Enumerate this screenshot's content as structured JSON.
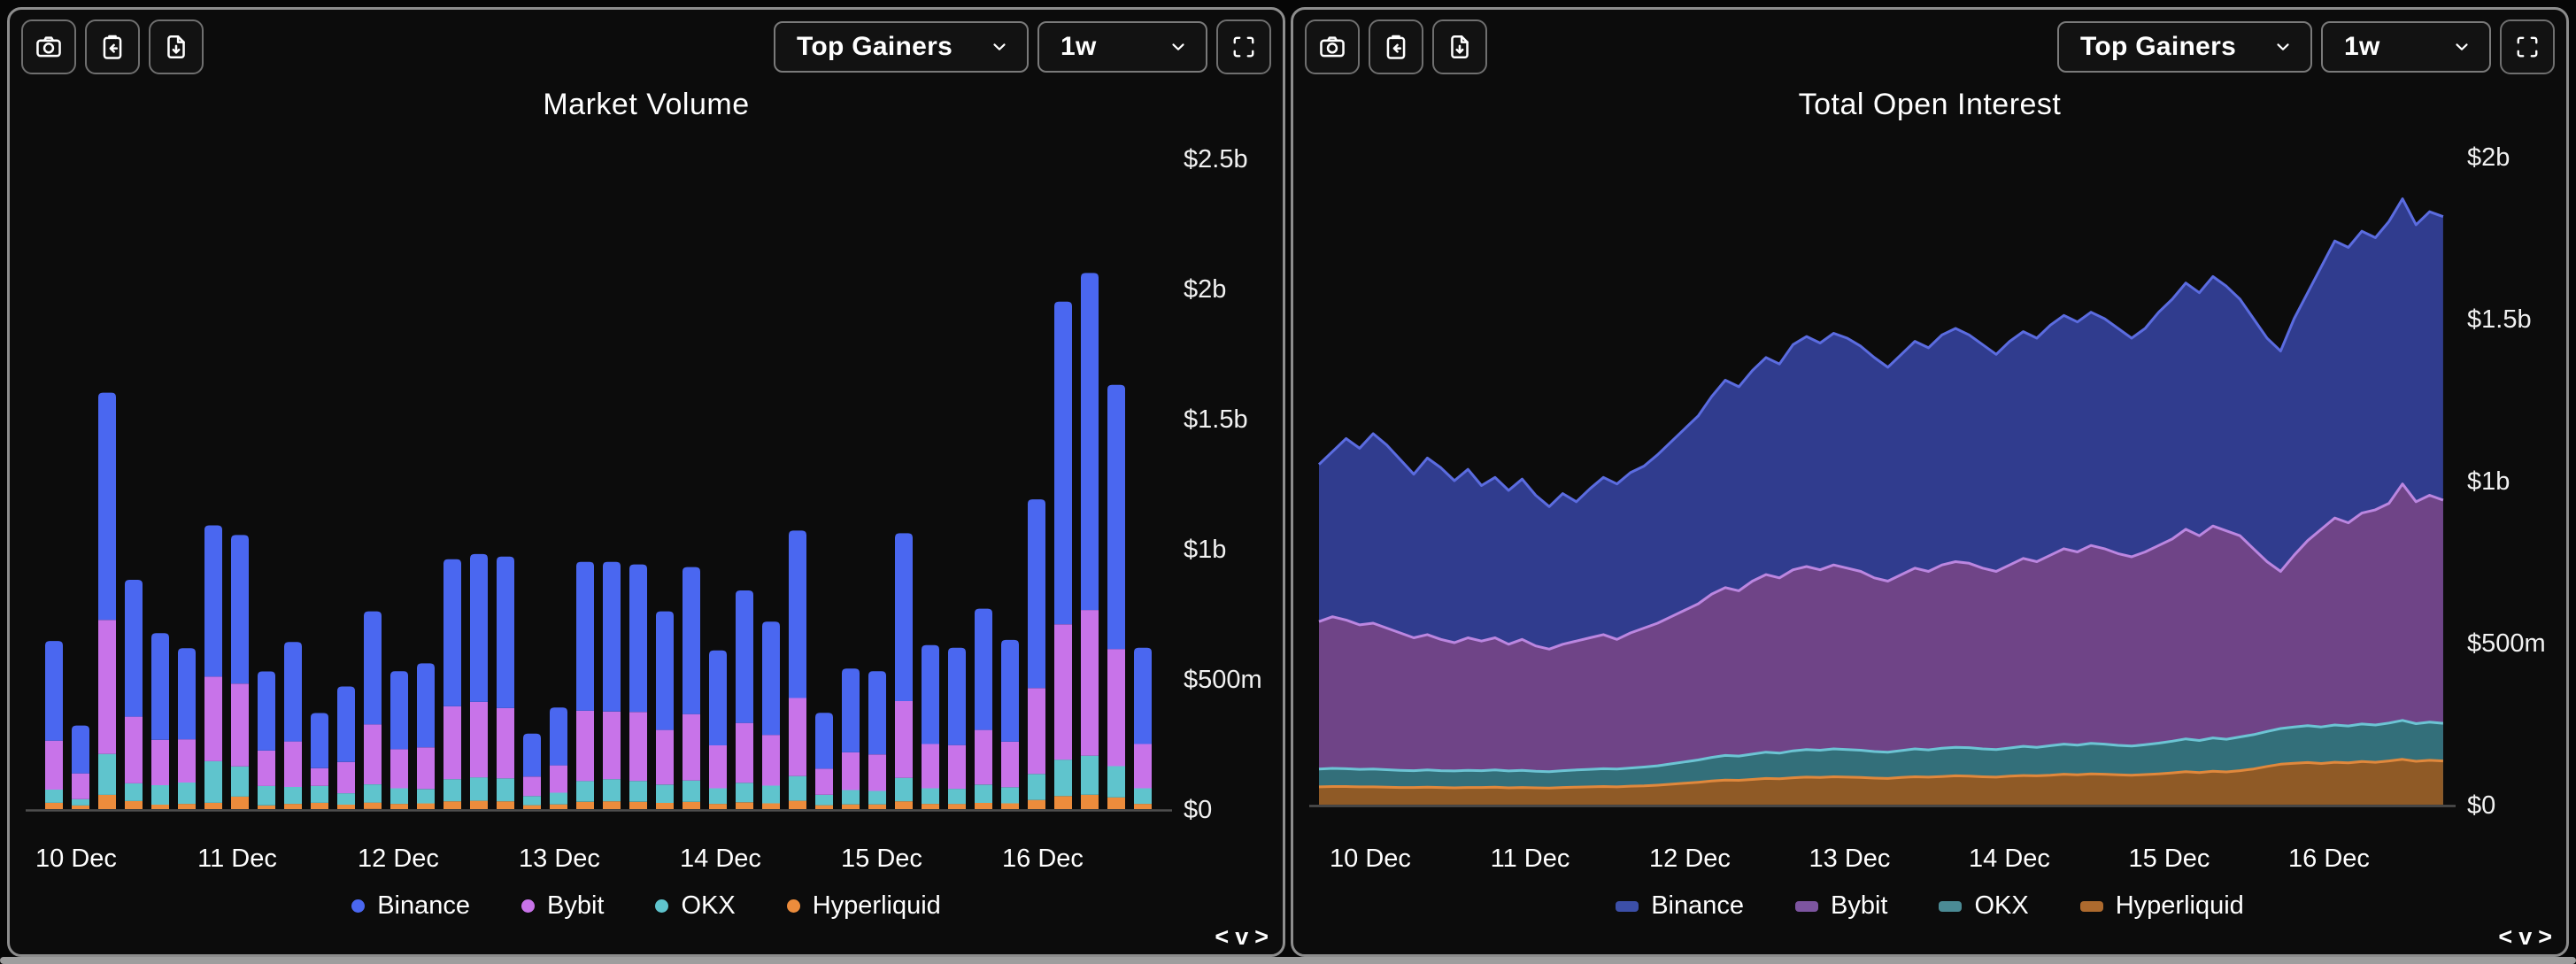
{
  "panels": [
    {
      "toolbar": {
        "screenshot_icon": "camera",
        "copy_icon": "clipboard-arrow",
        "export_icon": "file-download",
        "market_select": "Top Gainers",
        "range_select": "1w",
        "fullscreen_icon": "expand-corners"
      },
      "legend_marker": "dot",
      "legend": [
        {
          "label": "Binance",
          "color": "#4a67f0"
        },
        {
          "label": "Bybit",
          "color": "#c873e9"
        },
        {
          "label": "OKX",
          "color": "#5fc4cd"
        },
        {
          "label": "Hyperliquid",
          "color": "#ec8c3c"
        }
      ],
      "pager": [
        "<",
        "v",
        ">"
      ]
    },
    {
      "toolbar": {
        "screenshot_icon": "camera",
        "copy_icon": "clipboard-arrow",
        "export_icon": "file-download",
        "market_select": "Top Gainers",
        "range_select": "1w",
        "fullscreen_icon": "expand-corners"
      },
      "legend_marker": "chip",
      "legend": [
        {
          "label": "Binance",
          "color": "#3c4fa8"
        },
        {
          "label": "Bybit",
          "color": "#7d55a0"
        },
        {
          "label": "OKX",
          "color": "#4b8b95"
        },
        {
          "label": "Hyperliquid",
          "color": "#ad6a2e"
        }
      ],
      "pager": [
        "<",
        "v",
        ">"
      ]
    }
  ],
  "chart_data": [
    {
      "type": "bar",
      "title": "Market Volume",
      "unit": "USD millions",
      "interval": "4h",
      "x_labels": [
        "10 Dec",
        "11 Dec",
        "12 Dec",
        "13 Dec",
        "14 Dec",
        "15 Dec",
        "16 Dec"
      ],
      "y_ticks": [
        {
          "label": "$0",
          "value": 0
        },
        {
          "label": "$500m",
          "value": 500
        },
        {
          "label": "$1b",
          "value": 1000
        },
        {
          "label": "$1.5b",
          "value": 1500
        },
        {
          "label": "$2b",
          "value": 2000
        },
        {
          "label": "$2.5b",
          "value": 2500
        }
      ],
      "ylim": [
        0,
        2570
      ],
      "grid": false,
      "legend_position": "bottom",
      "series": [
        {
          "name": "Hyperliquid",
          "color": "#ec8c3c",
          "values": [
            24,
            14,
            55,
            31,
            17,
            20,
            24,
            48,
            14,
            20,
            24,
            17,
            25,
            20,
            22,
            30,
            32,
            30,
            15,
            18,
            28,
            30,
            28,
            24,
            28,
            20,
            26,
            22,
            32,
            15,
            18,
            18,
            30,
            20,
            20,
            24,
            22,
            35,
            50,
            55,
            45,
            20
          ]
        },
        {
          "name": "OKX",
          "color": "#5fc4cd",
          "values": [
            51,
            24,
            157,
            68,
            75,
            82,
            160,
            116,
            75,
            65,
            65,
            44,
            70,
            60,
            55,
            85,
            90,
            88,
            35,
            45,
            80,
            85,
            80,
            70,
            82,
            60,
            75,
            68,
            95,
            40,
            55,
            52,
            90,
            60,
            58,
            70,
            62,
            100,
            140,
            150,
            120,
            60
          ]
        },
        {
          "name": "Bybit",
          "color": "#c873e9",
          "values": [
            188,
            99,
            515,
            256,
            174,
            166,
            325,
            318,
            136,
            175,
            68,
            120,
            230,
            150,
            160,
            280,
            290,
            270,
            75,
            105,
            270,
            260,
            265,
            210,
            255,
            165,
            230,
            195,
            300,
            100,
            145,
            140,
            295,
            170,
            168,
            210,
            175,
            330,
            520,
            560,
            450,
            170
          ]
        },
        {
          "name": "Binance",
          "color": "#4a67f0",
          "values": [
            383,
            184,
            873,
            526,
            410,
            350,
            581,
            571,
            304,
            382,
            212,
            290,
            435,
            300,
            323,
            565,
            568,
            582,
            165,
            222,
            572,
            575,
            567,
            456,
            565,
            365,
            509,
            435,
            643,
            215,
            322,
            320,
            645,
            380,
            374,
            466,
            391,
            725,
            1240,
            1295,
            1015,
            370
          ]
        }
      ]
    },
    {
      "type": "area",
      "title": "Total Open Interest",
      "unit": "USD millions",
      "interval": "2h",
      "x_labels": [
        "10 Dec",
        "11 Dec",
        "12 Dec",
        "13 Dec",
        "14 Dec",
        "15 Dec",
        "16 Dec"
      ],
      "y_ticks": [
        {
          "label": "$0",
          "value": 0
        },
        {
          "label": "$500m",
          "value": 500
        },
        {
          "label": "$1b",
          "value": 1000
        },
        {
          "label": "$1.5b",
          "value": 1500
        },
        {
          "label": "$2b",
          "value": 2000
        }
      ],
      "ylim": [
        0,
        2180
      ],
      "grid": false,
      "legend_position": "bottom",
      "series": [
        {
          "name": "Hyperliquid",
          "fill": "#8f5a26",
          "stroke": "#e0883c",
          "values": [
            55,
            56,
            56,
            55,
            55,
            54,
            53,
            53,
            54,
            53,
            52,
            53,
            53,
            54,
            52,
            53,
            52,
            51,
            53,
            54,
            55,
            56,
            55,
            57,
            58,
            60,
            63,
            66,
            69,
            73,
            76,
            75,
            78,
            81,
            80,
            83,
            85,
            84,
            86,
            85,
            84,
            82,
            81,
            84,
            86,
            85,
            87,
            89,
            88,
            86,
            85,
            88,
            90,
            89,
            91,
            94,
            92,
            95,
            94,
            92,
            91,
            93,
            95,
            98,
            102,
            99,
            103,
            101,
            105,
            110,
            118,
            125,
            128,
            130,
            127,
            131,
            129,
            133,
            131,
            135,
            140,
            134,
            137,
            135
          ]
        },
        {
          "name": "OKX",
          "fill": "#336f7a",
          "stroke": "#6cc4d4",
          "values": [
            55,
            56,
            55,
            54,
            55,
            54,
            53,
            52,
            53,
            52,
            52,
            53,
            52,
            53,
            52,
            53,
            51,
            51,
            52,
            53,
            54,
            55,
            55,
            56,
            58,
            60,
            63,
            66,
            69,
            73,
            76,
            75,
            78,
            81,
            79,
            83,
            85,
            84,
            86,
            85,
            84,
            82,
            81,
            83,
            86,
            84,
            87,
            88,
            88,
            86,
            85,
            87,
            90,
            88,
            91,
            93,
            92,
            94,
            93,
            91,
            90,
            92,
            95,
            98,
            101,
            99,
            103,
            101,
            104,
            106,
            108,
            110,
            112,
            114,
            113,
            115,
            114,
            116,
            115,
            117,
            120,
            116,
            118,
            116
          ]
        },
        {
          "name": "Bybit",
          "fill": "#6f4487",
          "stroke": "#bb86e0",
          "values": [
            455,
            468,
            459,
            446,
            450,
            437,
            424,
            410,
            418,
            405,
            396,
            409,
            400,
            408,
            391,
            404,
            387,
            378,
            390,
            398,
            406,
            414,
            400,
            417,
            429,
            440,
            454,
            468,
            482,
            504,
            518,
            510,
            534,
            548,
            541,
            559,
            565,
            557,
            568,
            560,
            552,
            536,
            528,
            543,
            558,
            551,
            566,
            573,
            569,
            558,
            550,
            565,
            580,
            573,
            588,
            603,
            596,
            611,
            603,
            592,
            584,
            595,
            610,
            624,
            647,
            632,
            654,
            643,
            621,
            574,
            524,
            485,
            530,
            571,
            610,
            639,
            627,
            651,
            664,
            678,
            730,
            685,
            700,
            689
          ]
        },
        {
          "name": "Binance",
          "fill": "#303c8e",
          "stroke": "#5b6ce0",
          "values": [
            485,
            510,
            560,
            545,
            585,
            565,
            535,
            505,
            545,
            530,
            500,
            520,
            480,
            495,
            475,
            495,
            465,
            440,
            465,
            430,
            460,
            485,
            480,
            495,
            500,
            520,
            540,
            560,
            580,
            610,
            640,
            630,
            650,
            670,
            660,
            695,
            710,
            700,
            715,
            710,
            695,
            680,
            660,
            680,
            700,
            690,
            710,
            720,
            705,
            690,
            670,
            690,
            700,
            690,
            710,
            720,
            710,
            720,
            710,
            695,
            675,
            690,
            720,
            740,
            760,
            750,
            770,
            755,
            730,
            710,
            690,
            680,
            730,
            765,
            810,
            855,
            850,
            870,
            840,
            870,
            880,
            855,
            875,
            875
          ]
        }
      ]
    }
  ]
}
